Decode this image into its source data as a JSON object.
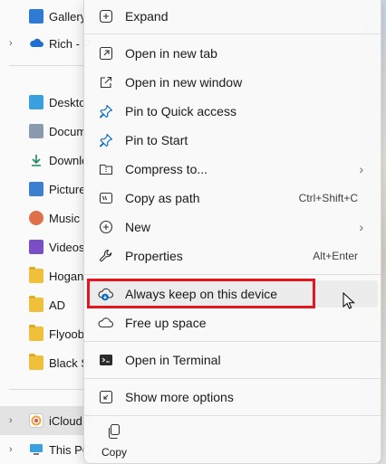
{
  "nav": {
    "items": [
      {
        "label": "Gallery",
        "icon": "gallery-icon",
        "chevron": ""
      },
      {
        "label": "Rich - P",
        "icon": "onedrive-cloud-icon",
        "chevron": "›"
      },
      {
        "label": "Deskto",
        "icon": "desktop-icon",
        "chevron": ""
      },
      {
        "label": "Docum",
        "icon": "documents-icon",
        "chevron": ""
      },
      {
        "label": "Downlo",
        "icon": "downloads-icon",
        "chevron": ""
      },
      {
        "label": "Picture",
        "icon": "pictures-icon",
        "chevron": ""
      },
      {
        "label": "Music",
        "icon": "music-icon",
        "chevron": ""
      },
      {
        "label": "Videos",
        "icon": "videos-icon",
        "chevron": ""
      },
      {
        "label": "Hogan",
        "icon": "folder-icon",
        "chevron": ""
      },
      {
        "label": "AD",
        "icon": "folder-icon",
        "chevron": ""
      },
      {
        "label": "Flyoob",
        "icon": "folder-icon",
        "chevron": ""
      },
      {
        "label": "Black S",
        "icon": "folder-icon",
        "chevron": ""
      },
      {
        "label": "iCloud",
        "icon": "icloud-icon",
        "chevron": "›"
      },
      {
        "label": "This PC",
        "icon": "this-pc-icon",
        "chevron": "›"
      }
    ]
  },
  "menu": {
    "expand": "Expand",
    "open_new_tab": "Open in new tab",
    "open_new_window": "Open in new window",
    "pin_quick_access": "Pin to Quick access",
    "pin_start": "Pin to Start",
    "compress": "Compress to...",
    "copy_as_path": "Copy as path",
    "copy_as_path_shortcut": "Ctrl+Shift+C",
    "new": "New",
    "properties": "Properties",
    "properties_shortcut": "Alt+Enter",
    "always_keep": "Always keep on this device",
    "free_up_space": "Free up space",
    "open_terminal": "Open in Terminal",
    "show_more": "Show more options",
    "copy": "Copy",
    "submenu_arrow": "›"
  },
  "colors": {
    "highlight_border": "#e4161f",
    "accent": "#0067c0",
    "folder": "#f0c03a"
  }
}
